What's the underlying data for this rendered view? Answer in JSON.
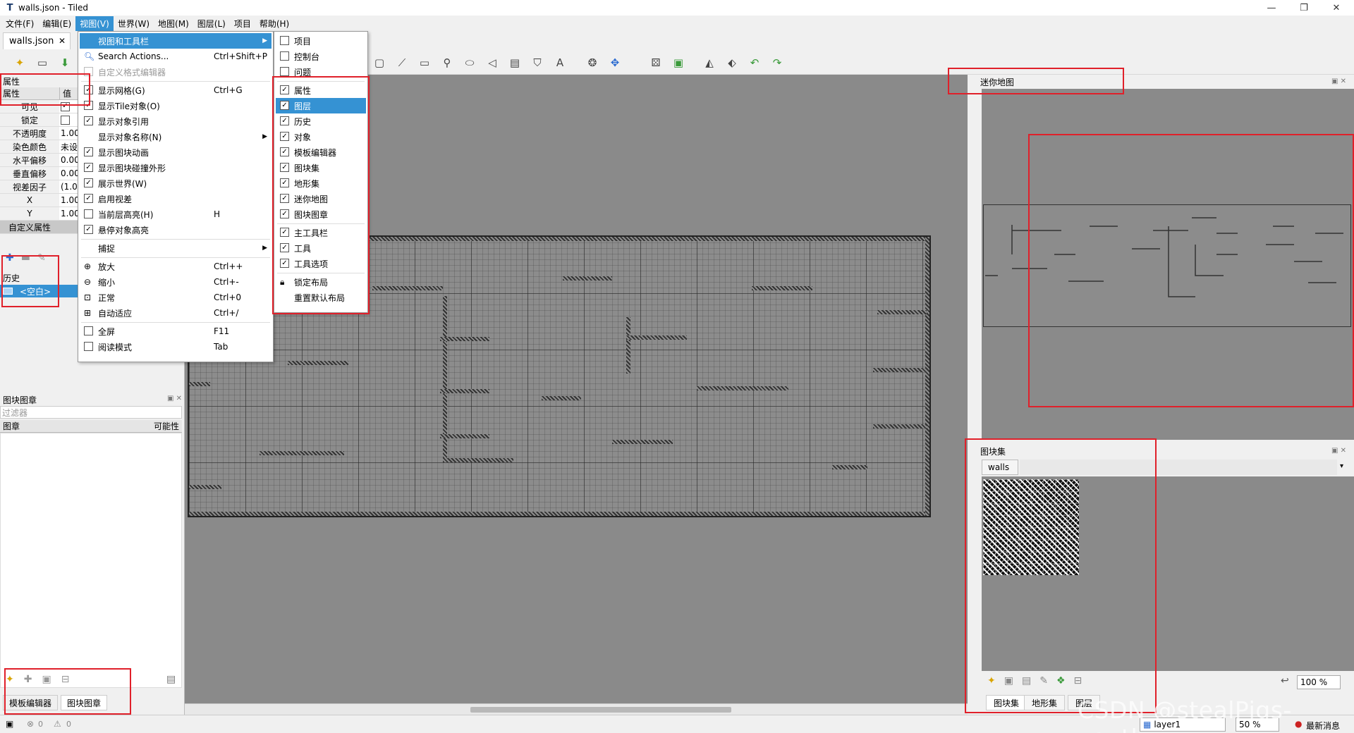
{
  "window": {
    "title": "walls.json - Tiled"
  },
  "menubar": [
    "文件(F)",
    "编辑(E)",
    "视图(V)",
    "世界(W)",
    "地图(M)",
    "图层(L)",
    "项目",
    "帮助(H)"
  ],
  "doc_tab": {
    "label": "walls.json"
  },
  "properties": {
    "dock_title": "属性",
    "col_prop": "属性",
    "col_value": "值",
    "rows": [
      {
        "key": "可见",
        "value": ""
      },
      {
        "key": "锁定",
        "value": ""
      },
      {
        "key": "不透明度",
        "value": "1.00"
      },
      {
        "key": "染色颜色",
        "value": "未设"
      },
      {
        "key": "水平偏移",
        "value": "0.00"
      },
      {
        "key": "垂直偏移",
        "value": "0.00"
      },
      {
        "key": "视差因子",
        "value": "(1.0"
      },
      {
        "key": "X",
        "value": "1.00"
      },
      {
        "key": "Y",
        "value": "1.00"
      }
    ],
    "custom_group": "自定义属性"
  },
  "history": {
    "title": "历史",
    "entry": "<空白>"
  },
  "stamps": {
    "title": "图块图章",
    "filter_placeholder": "过滤器",
    "col_stamp": "图章",
    "col_prob": "可能性"
  },
  "left_bottom_tabs": [
    "模板编辑器",
    "图块图章"
  ],
  "view_menu": {
    "items": [
      {
        "label": "视图和工具栏",
        "shortcut": ""
      },
      {
        "label": "Search Actions...",
        "shortcut": "Ctrl+Shift+P"
      },
      {
        "label": "自定义格式编辑器",
        "shortcut": ""
      },
      {
        "label": "显示网格(G)",
        "shortcut": "Ctrl+G"
      },
      {
        "label": "显示Tile对象(O)",
        "shortcut": ""
      },
      {
        "label": "显示对象引用",
        "shortcut": ""
      },
      {
        "label": "显示对象名称(N)",
        "shortcut": ""
      },
      {
        "label": "显示图块动画",
        "shortcut": ""
      },
      {
        "label": "显示图块碰撞外形",
        "shortcut": ""
      },
      {
        "label": "展示世界(W)",
        "shortcut": ""
      },
      {
        "label": "启用视差",
        "shortcut": ""
      },
      {
        "label": "当前层高亮(H)",
        "shortcut": "H"
      },
      {
        "label": "悬停对象高亮",
        "shortcut": ""
      },
      {
        "label": "捕捉",
        "shortcut": ""
      },
      {
        "label": "放大",
        "shortcut": "Ctrl++"
      },
      {
        "label": "缩小",
        "shortcut": "Ctrl+-"
      },
      {
        "label": "正常",
        "shortcut": "Ctrl+0"
      },
      {
        "label": "自动适应",
        "shortcut": "Ctrl+/"
      },
      {
        "label": "全屏",
        "shortcut": "F11"
      },
      {
        "label": "阅读模式",
        "shortcut": "Tab"
      }
    ]
  },
  "views_submenu": {
    "items": [
      "项目",
      "控制台",
      "问题",
      "属性",
      "图层",
      "历史",
      "对象",
      "模板编辑器",
      "图块集",
      "地形集",
      "迷你地图",
      "图块图章",
      "主工具栏",
      "工具",
      "工具选项",
      "锁定布局",
      "重置默认布局"
    ]
  },
  "minimap": {
    "title": "迷你地图"
  },
  "tileset": {
    "title": "图块集",
    "tab": "walls",
    "zoom": "100 %"
  },
  "right_bottom_tabs": [
    "图块集",
    "地形集",
    "图层"
  ],
  "statusbar": {
    "errors": "0",
    "warnings": "0",
    "layer": "layer1",
    "zoom": "50 %",
    "news": "最新消息"
  },
  "watermark": "CSDN @stealPigs-youth"
}
